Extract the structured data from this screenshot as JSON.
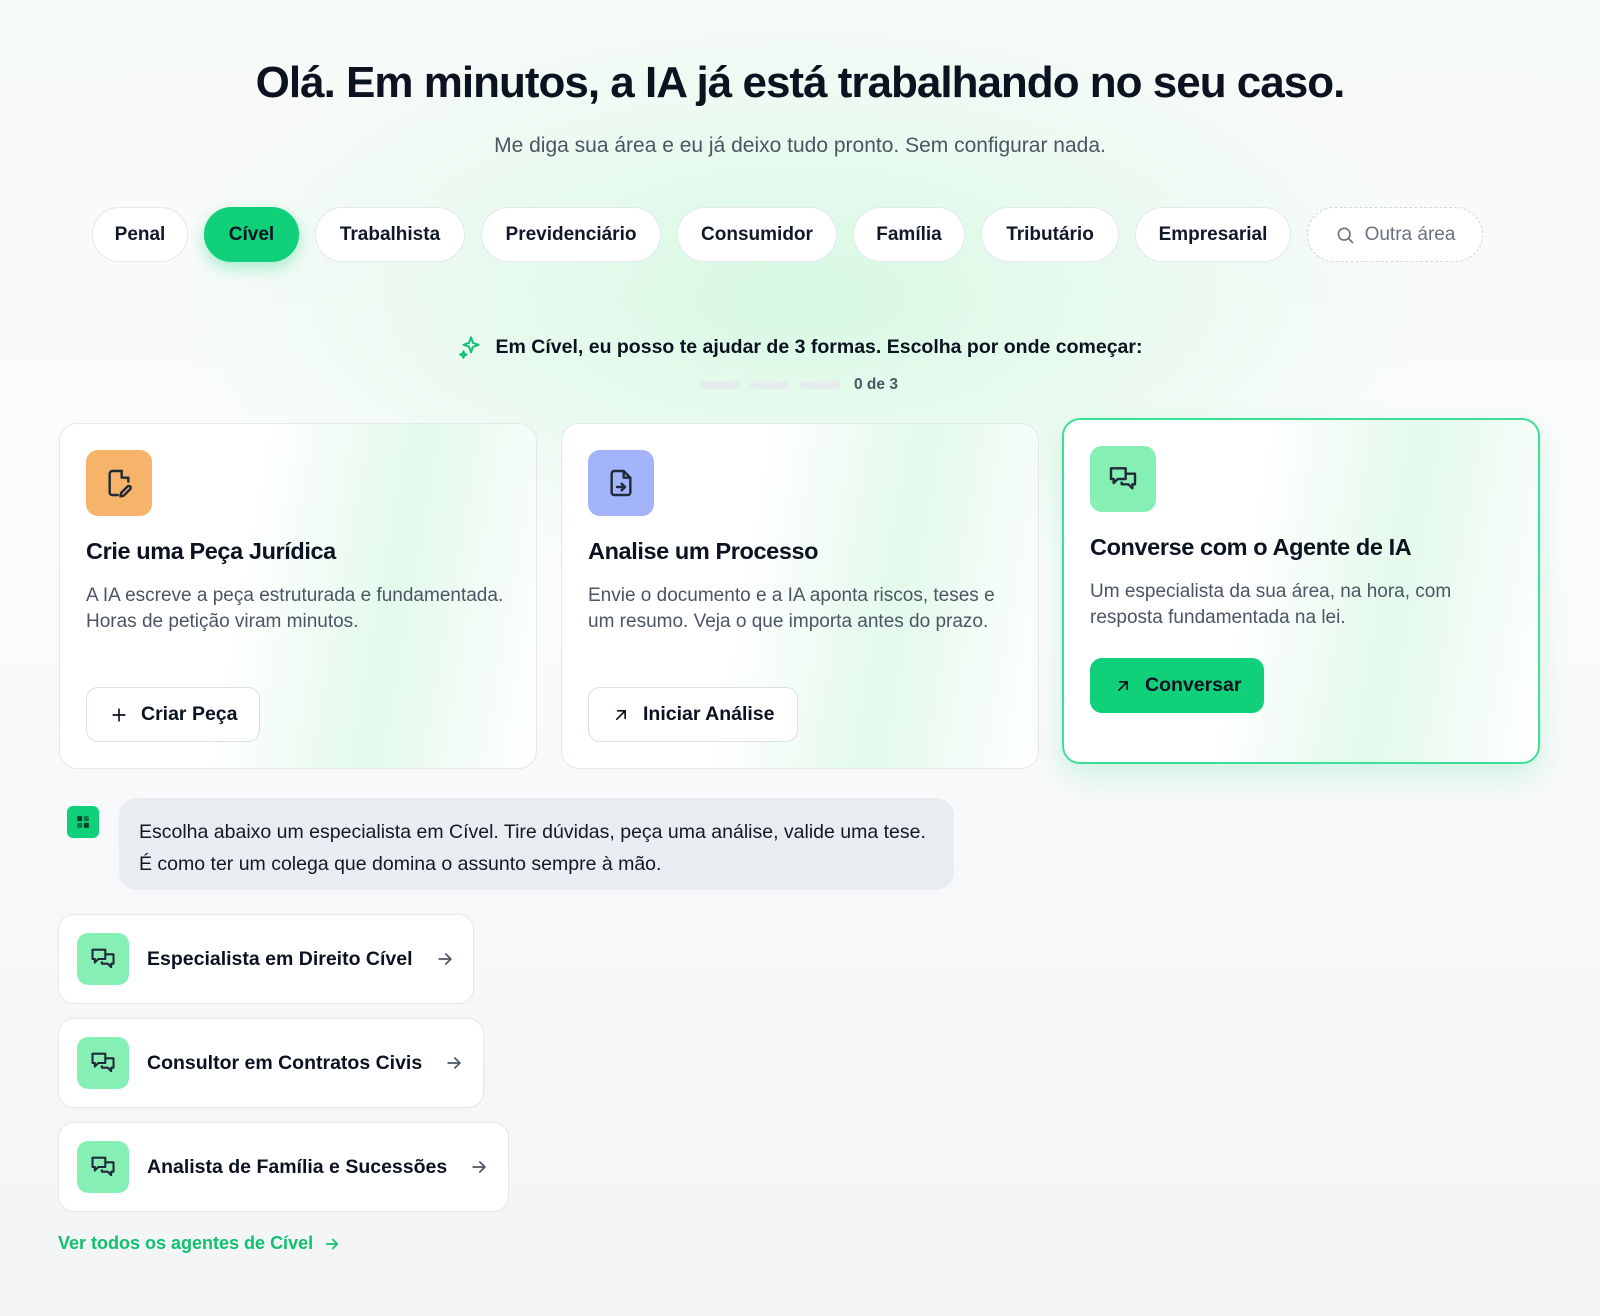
{
  "header": {
    "title": "Olá. Em minutos, a IA já está trabalhando no seu caso.",
    "subtitle": "Me diga sua área e eu já deixo tudo pronto. Sem configurar nada."
  },
  "areas": {
    "items": [
      {
        "label": "Penal",
        "active": false
      },
      {
        "label": "Cível",
        "active": true
      },
      {
        "label": "Trabalhista",
        "active": false
      },
      {
        "label": "Previdenciário",
        "active": false
      },
      {
        "label": "Consumidor",
        "active": false
      },
      {
        "label": "Família",
        "active": false
      },
      {
        "label": "Tributário",
        "active": false
      },
      {
        "label": "Empresarial",
        "active": false
      }
    ],
    "other_label": "Outra área"
  },
  "help": {
    "text": "Em Cível, eu posso te ajudar de 3 formas. Escolha por onde começar:",
    "progress_label": "0 de 3",
    "progress_done": 0,
    "progress_total": 3
  },
  "cards": [
    {
      "title": "Crie uma Peça Jurídica",
      "description": "A IA escreve a peça estruturada e fundamentada. Horas de petição viram minutos.",
      "button": "Criar Peça",
      "icon": "file-edit-icon",
      "icon_color": "#f6b46a"
    },
    {
      "title": "Analise um Processo",
      "description": "Envie o documento e a IA aponta riscos, teses e um resumo. Veja o que importa antes do prazo.",
      "button": "Iniciar Análise",
      "icon": "file-import-icon",
      "icon_color": "#a3b4fa"
    },
    {
      "title": "Converse com o Agente de IA",
      "description": "Um especialista da sua área, na hora, com resposta fundamentada na lei.",
      "button": "Conversar",
      "icon": "chat-bubbles-icon",
      "icon_color": "#86efb3"
    }
  ],
  "assistant": {
    "message": "Escolha abaixo um especialista em Cível. Tire dúvidas, peça uma análise, valide uma tese. É como ter um colega que domina o assunto sempre à mão."
  },
  "agents": [
    {
      "label": "Especialista em Direito Cível"
    },
    {
      "label": "Consultor em Contratos Civis"
    },
    {
      "label": "Analista de Família e Sucessões"
    }
  ],
  "see_all": "Ver todos os agentes de Cível",
  "colors": {
    "accent": "#10d07a",
    "text": "#0b1220",
    "muted": "#4b5563"
  }
}
